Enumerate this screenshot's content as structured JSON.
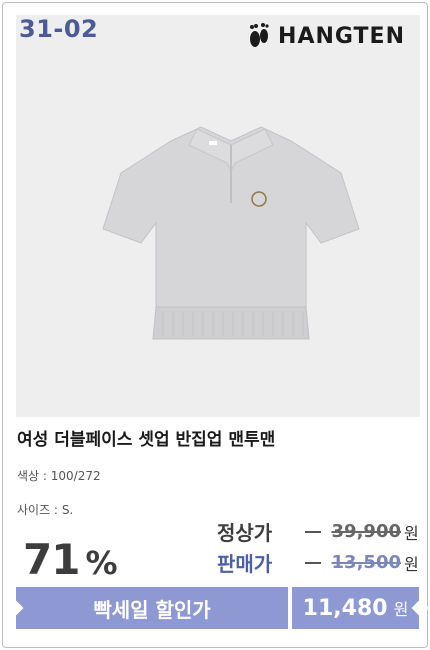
{
  "product_code": "31-02",
  "brand": {
    "name": "HANGTEN",
    "logo_icon": "footprint-icon"
  },
  "product": {
    "title": "여성 더블페이스 셋업 반집업 맨투맨",
    "color_label": "색상 :",
    "color_value": "100/272",
    "size_label": "사이즈 :",
    "size_value": "S."
  },
  "discount": {
    "number": "71",
    "symbol": "%"
  },
  "prices": {
    "regular_label": "정상가",
    "regular_value": "39,900",
    "sale_label": "판매가",
    "sale_value": "13,500",
    "unit": "원"
  },
  "promo": {
    "label": "빡세일 할인가",
    "price": "11,480",
    "unit": "원",
    "bar_color": "#8e98d2"
  },
  "colors": {
    "code_text": "#4a5b96",
    "sale_label": "#4c5fa6",
    "photo_bg": "#eeeeee"
  }
}
